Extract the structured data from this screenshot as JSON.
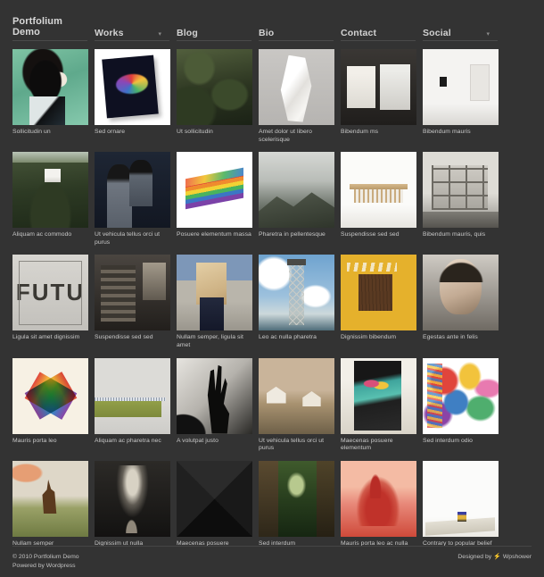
{
  "site": {
    "title_line1": "Portfolium",
    "title_line2": "Demo"
  },
  "nav": {
    "items": [
      {
        "label": "Works",
        "has_dropdown": true
      },
      {
        "label": "Blog",
        "has_dropdown": false
      },
      {
        "label": "Bio",
        "has_dropdown": false
      },
      {
        "label": "Contact",
        "has_dropdown": false
      },
      {
        "label": "Social",
        "has_dropdown": true
      }
    ],
    "dropdown_glyph": "▾"
  },
  "grid": {
    "rows": [
      {
        "items": [
          {
            "caption": "Sollicitudin un"
          },
          {
            "caption": "Sed ornare"
          },
          {
            "caption": "Ut sollicitudin"
          },
          {
            "caption": "Amet dolor ut libero scelerisque"
          },
          {
            "caption": "Bibendum ms"
          },
          {
            "caption": "Bibendum mauris"
          }
        ]
      },
      {
        "items": [
          {
            "caption": "Aliquam ac commodo"
          },
          {
            "caption": "Ut vehicula tellus orci ut purus"
          },
          {
            "caption": "Posuere elementum massa"
          },
          {
            "caption": "Pharetra in pellentesque"
          },
          {
            "caption": "Suspendisse sed sed"
          },
          {
            "caption": "Bibendum mauris, quis"
          }
        ]
      },
      {
        "items": [
          {
            "caption": "Ligula sit amet dignissim"
          },
          {
            "caption": "Suspendisse sed sed"
          },
          {
            "caption": "Nullam semper, ligula sit amet"
          },
          {
            "caption": "Leo ac nulla pharetra"
          },
          {
            "caption": "Dignissim bibendum"
          },
          {
            "caption": "Egestas ante in felis"
          }
        ]
      },
      {
        "items": [
          {
            "caption": "Mauris porta leo"
          },
          {
            "caption": "Aliquam ac pharetra nec"
          },
          {
            "caption": "A volutpat justo"
          },
          {
            "caption": "Ut vehicula tellus orci ut purus"
          },
          {
            "caption": "Maecenas posuere elementum"
          },
          {
            "caption": "Sed interdum odio"
          }
        ]
      },
      {
        "items": [
          {
            "caption": "Nullam semper"
          },
          {
            "caption": "Dignissim ut nulla"
          },
          {
            "caption": "Maecenas posuere"
          },
          {
            "caption": "Sed interdum"
          },
          {
            "caption": "Mauris porta leo ac nulla"
          },
          {
            "caption": "Contrary to popular belief"
          }
        ]
      }
    ]
  },
  "footer": {
    "copyright": "© 2010 Portfolium Demo",
    "powered_by": "Powered by Wordpress",
    "designed_by": "Designed by",
    "designer": "Wpshower",
    "bolt_glyph": "⚡"
  },
  "colors": {
    "page_background": "#333333",
    "text_primary": "#d2d2d2",
    "text_caption": "#c9c9c9",
    "rule": "#4a4a4a"
  }
}
